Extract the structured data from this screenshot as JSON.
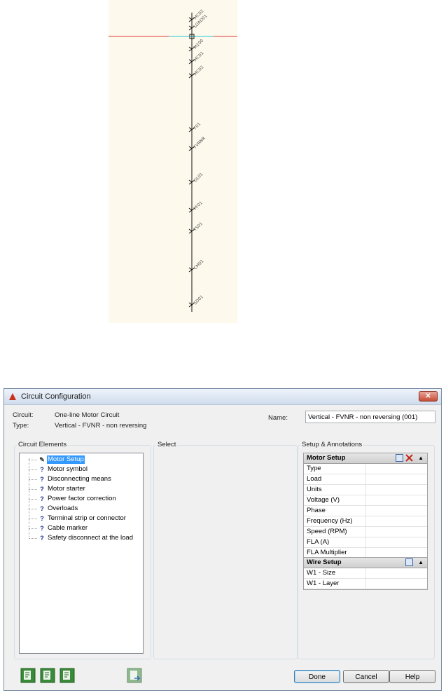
{
  "preview": {
    "tags": [
      "M100",
      "MC01",
      "MC02",
      "F01",
      "FVRNR",
      "OL01",
      "PF01",
      "TS01",
      "CM01",
      "SD01",
      "MC02",
      "LOAD01"
    ]
  },
  "dialog": {
    "title": "Circuit Configuration",
    "close_label": "✕",
    "circuit_label": "Circuit:",
    "circuit_value": "One-line Motor Circuit",
    "type_label": "Type:",
    "type_value": "Vertical - FVNR - non reversing",
    "name_label": "Name:",
    "name_value": "Vertical - FVNR - non reversing (001)",
    "circuit_elements": {
      "title": "Circuit Elements",
      "items": [
        {
          "label": "Motor Setup",
          "icon": "pencil-icon",
          "selected": true
        },
        {
          "label": "Motor symbol",
          "icon": "question-icon"
        },
        {
          "label": "Disconnecting means",
          "icon": "question-icon"
        },
        {
          "label": "Motor starter",
          "icon": "question-icon"
        },
        {
          "label": "Power factor correction",
          "icon": "question-icon"
        },
        {
          "label": "Overloads",
          "icon": "question-icon"
        },
        {
          "label": "Terminal strip or connector",
          "icon": "question-icon"
        },
        {
          "label": "Cable marker",
          "icon": "question-icon"
        },
        {
          "label": "Safety disconnect at the load",
          "icon": "question-icon"
        }
      ]
    },
    "select": {
      "title": "Select"
    },
    "setup": {
      "title": "Setup & Annotations",
      "motor_setup": {
        "header": "Motor Setup",
        "rows": [
          "Type",
          "Load",
          "Units",
          "Voltage (V)",
          "Phase",
          "Frequency (Hz)",
          "Speed (RPM)",
          "FLA (A)",
          "FLA Multiplier"
        ]
      },
      "wire_setup": {
        "header": "Wire Setup",
        "rows": [
          "W1 - Size",
          "W1 - Layer"
        ]
      }
    },
    "buttons": {
      "done": "Done",
      "cancel": "Cancel",
      "help": "Help"
    }
  }
}
